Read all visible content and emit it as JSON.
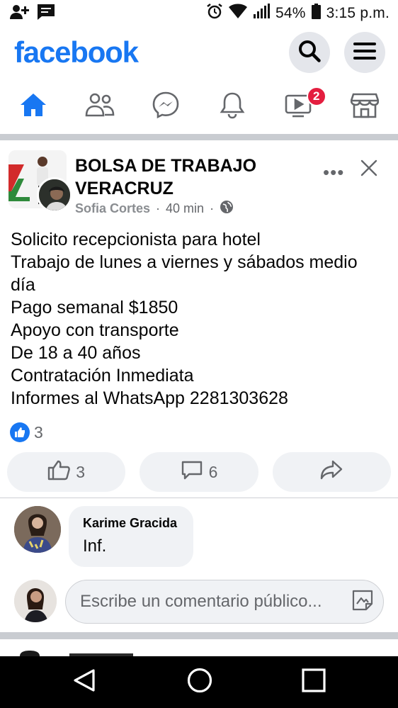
{
  "status_bar": {
    "battery": "54%",
    "time": "3:15 p.m."
  },
  "header": {
    "logo": "facebook"
  },
  "nav": {
    "watch_badge": "2"
  },
  "post": {
    "page_name": "BOLSA DE TRABAJO VERACRUZ",
    "author": "Sofia Cortes",
    "time": "40 min",
    "separator": "·",
    "more": "•••",
    "lines": [
      "Solicito recepcionista para hotel",
      "Trabajo de lunes a viernes y sábados medio",
      "día",
      "Pago semanal $1850",
      "Apoyo con transporte",
      "De 18 a 40 años",
      "Contratación Inmediata",
      "Informes al WhatsApp 2281303628"
    ],
    "reaction_count": "3",
    "like_count": "3",
    "comment_count": "6"
  },
  "comment": {
    "name": "Karime Gracida",
    "text": "Inf."
  },
  "write_comment": {
    "placeholder": "Escribe un comentario público..."
  },
  "colors": {
    "brand": "#1877f2",
    "badge": "#e41e3f",
    "muted": "#65676b",
    "bubble": "#f0f2f5"
  }
}
